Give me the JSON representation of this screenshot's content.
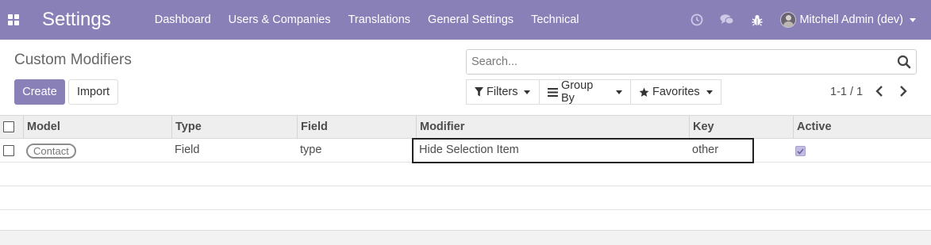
{
  "navbar": {
    "brand": "Settings",
    "menu": [
      "Dashboard",
      "Users & Companies",
      "Translations",
      "General Settings",
      "Technical"
    ],
    "user_name": "Mitchell Admin (dev)"
  },
  "control_panel": {
    "title": "Custom Modifiers",
    "create_label": "Create",
    "import_label": "Import",
    "search_placeholder": "Search...",
    "filters_label": "Filters",
    "group_by_label": "Group By",
    "favorites_label": "Favorites",
    "pager_text": "1-1 / 1"
  },
  "table": {
    "columns": [
      "Model",
      "Type",
      "Field",
      "Modifier",
      "Key",
      "Active"
    ],
    "rows": [
      {
        "model": "Contact",
        "type": "Field",
        "field": "type",
        "modifier": "Hide Selection Item",
        "key": "other",
        "active": true
      }
    ]
  },
  "colors": {
    "brand": "#8a80b8"
  }
}
